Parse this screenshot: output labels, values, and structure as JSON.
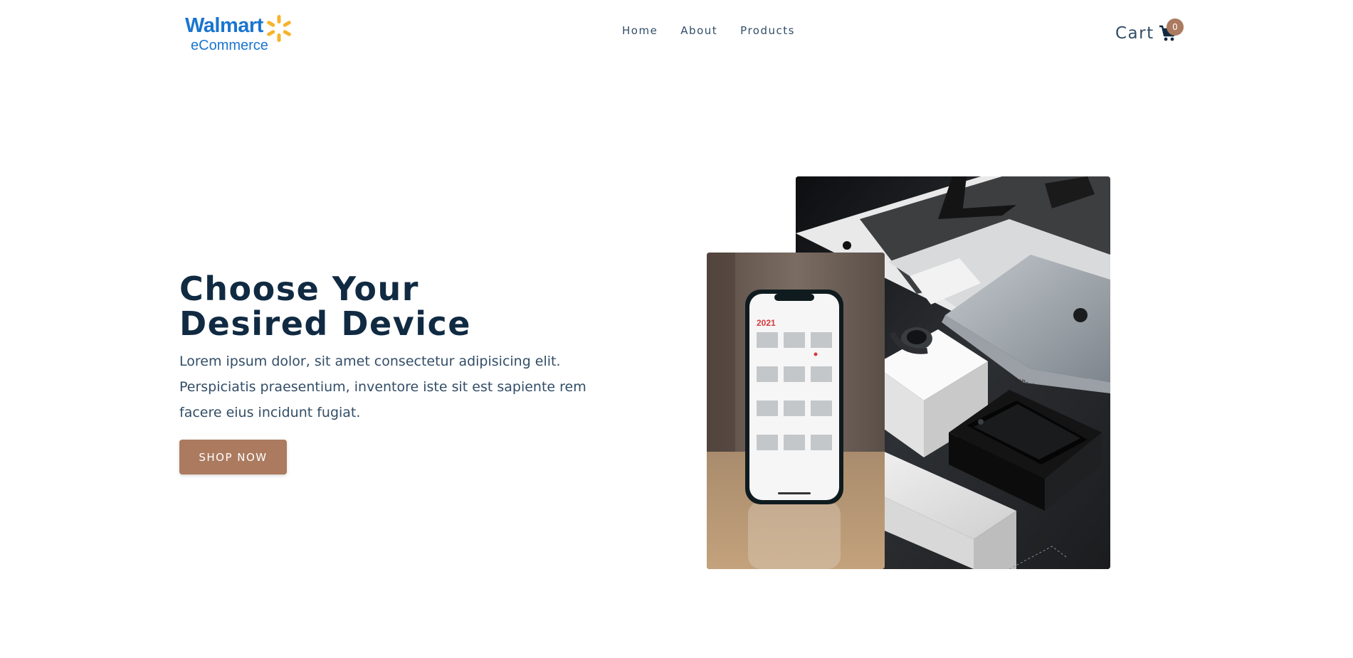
{
  "header": {
    "logo": {
      "brand": "Walmart",
      "subtitle": "eCommerce",
      "brand_color": "#1a75cf",
      "spark_color": "#f7b32b"
    },
    "nav": [
      {
        "label": "Home"
      },
      {
        "label": "About"
      },
      {
        "label": "Products"
      }
    ],
    "cart": {
      "label": "Cart",
      "count": "0",
      "icon": "shopping-cart-icon"
    }
  },
  "hero": {
    "title_line1": "Choose Your",
    "title_line2": "Desired Device",
    "description": "Lorem ipsum dolor, sit amet consectetur adipisicing elit. Perspiciatis praesentium, inventore iste sit est sapiente rem facere eius incidunt fugiat.",
    "button_label": "SHOP NOW",
    "main_image": "apple-devices-desk-photo",
    "accent_image": "iphone-calendar-photo",
    "phone_calendar_year": "2021"
  },
  "colors": {
    "primary_text": "#102a42",
    "body_text": "#324d67",
    "accent": "#ab7a5f",
    "background": "#ffffff"
  }
}
